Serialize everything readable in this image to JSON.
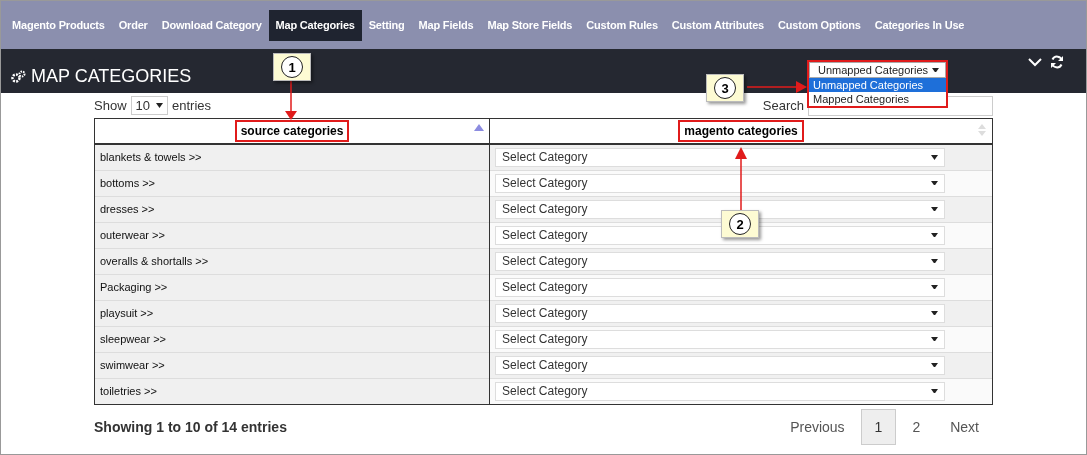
{
  "nav": {
    "tabs": [
      {
        "label": "Magento Products",
        "selected": false
      },
      {
        "label": "Order",
        "selected": false
      },
      {
        "label": "Download Category",
        "selected": false
      },
      {
        "label": "Map Categories",
        "selected": true
      },
      {
        "label": "Setting",
        "selected": false
      },
      {
        "label": "Map Fields",
        "selected": false
      },
      {
        "label": "Map Store Fields",
        "selected": false
      },
      {
        "label": "Custom Rules",
        "selected": false
      },
      {
        "label": "Custom Attributes",
        "selected": false
      },
      {
        "label": "Custom Options",
        "selected": false
      },
      {
        "label": "Categories In Use",
        "selected": false
      }
    ]
  },
  "panel": {
    "title": "MAP CATEGORIES",
    "filter": {
      "value": "Unmapped Categories",
      "expanded": true,
      "options": [
        {
          "label": "Unmapped Categories",
          "selected": true
        },
        {
          "label": "Mapped Categories",
          "selected": false
        }
      ]
    }
  },
  "length": {
    "before": "Show",
    "value": "10",
    "after": "entries"
  },
  "search": {
    "label": "Search"
  },
  "table": {
    "columns": [
      {
        "label": "source categories",
        "sorted": true
      },
      {
        "label": "magento categories",
        "sorted": false
      }
    ],
    "rows": [
      {
        "source": "blankets & towels >>",
        "magento": "Select Category"
      },
      {
        "source": "bottoms >>",
        "magento": "Select Category"
      },
      {
        "source": "dresses >>",
        "magento": "Select Category"
      },
      {
        "source": "outerwear >>",
        "magento": "Select Category"
      },
      {
        "source": "overalls & shortalls >>",
        "magento": "Select Category"
      },
      {
        "source": "Packaging >>",
        "magento": "Select Category"
      },
      {
        "source": "playsuit >>",
        "magento": "Select Category"
      },
      {
        "source": "sleepwear >>",
        "magento": "Select Category"
      },
      {
        "source": "swimwear >>",
        "magento": "Select Category"
      },
      {
        "source": "toiletries >>",
        "magento": "Select Category"
      }
    ]
  },
  "info": "Showing 1 to 10 of 14 entries",
  "pagination": {
    "previous": "Previous",
    "pages": [
      {
        "label": "1",
        "selected": true
      },
      {
        "label": "2",
        "selected": false
      }
    ],
    "next": "Next"
  },
  "callouts": [
    {
      "number": "1"
    },
    {
      "number": "2"
    },
    {
      "number": "3"
    }
  ]
}
